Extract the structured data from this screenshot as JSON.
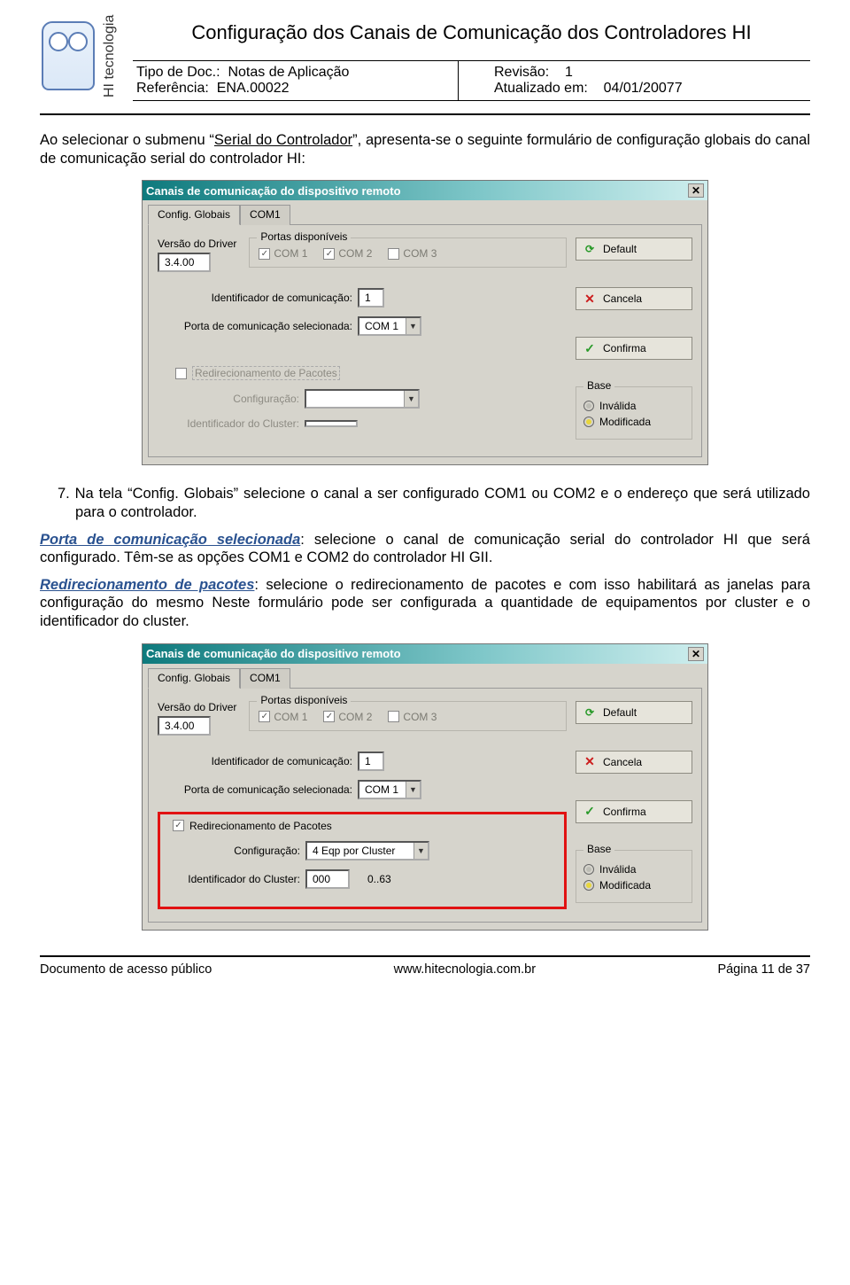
{
  "header": {
    "company": "HI tecnologia",
    "title": "Configuração dos Canais de Comunicação dos Controladores HI",
    "tipoDocLabel": "Tipo de Doc.:",
    "tipoDocValue": "Notas de Aplicação",
    "referenciaLabel": "Referência:",
    "referenciaValue": "ENA.00022",
    "revisaoLabel": "Revisão:",
    "revisaoValue": "1",
    "atualizadoLabel": "Atualizado em:",
    "atualizadoValue": "04/01/20077"
  },
  "text": {
    "p1a": "Ao selecionar o submenu “",
    "p1link": "Serial do Controlador",
    "p1b": "”, apresenta-se o seguinte formulário de configuração globais do canal de comunicação serial do controlador HI:",
    "p2num": "7.",
    "p2": " Na tela “Config. Globais” selecione o canal a ser configurado COM1 ou COM2 e o endereço que será utilizado para o controlador.",
    "p3label": "Porta de comunicação selecionada",
    "p3rest": ": selecione o canal de comunicação serial do controlador HI que será configurado. Têm-se as opções COM1 e COM2 do controlador HI GII.",
    "p4label": "Redirecionamento de pacotes",
    "p4rest": ": selecione o redirecionamento de pacotes e com isso habilitará as janelas para configuração do mesmo Neste formulário pode ser configurada a quantidade de equipamentos por cluster e o identificador do cluster."
  },
  "dialog": {
    "title": "Canais de comunicação do dispositivo remoto",
    "tabGlobais": "Config. Globais",
    "tabCom1": "COM1",
    "versionLabel": "Versão do Driver",
    "versionValue": "3.4.00",
    "portasLegend": "Portas disponíveis",
    "com1": "COM 1",
    "com2": "COM 2",
    "com3": "COM 3",
    "identLabel": "Identificador de comunicação:",
    "identValue": "1",
    "portaSelLabel": "Porta de comunicação selecionada:",
    "portaSelValue": "COM 1",
    "redirectLabel": "Redirecionamento de Pacotes",
    "configLabel": "Configuração:",
    "configValue2": "4 Eqp por Cluster",
    "clusterLabel": "Identificador do Cluster:",
    "clusterValue2": "000",
    "clusterRange": "0..63",
    "btnDefault": "Default",
    "btnCancela": "Cancela",
    "btnConfirma": "Confirma",
    "baseLegend": "Base",
    "baseInvalida": "Inválida",
    "baseModificada": "Modificada"
  },
  "footer": {
    "left": "Documento de acesso público",
    "center": "www.hitecnologia.com.br",
    "right": "Página 11 de 37"
  }
}
